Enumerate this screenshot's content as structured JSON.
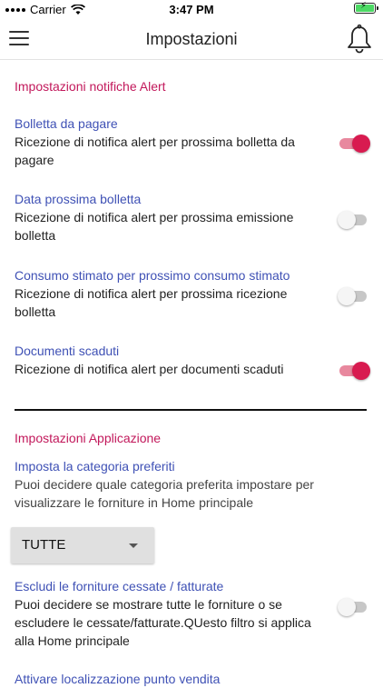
{
  "status_bar": {
    "carrier": "Carrier",
    "time": "3:47 PM"
  },
  "header": {
    "title": "Impostazioni"
  },
  "alerts_section": {
    "title": "Impostazioni notifiche Alert",
    "items": [
      {
        "title": "Bolletta da pagare",
        "desc": "Ricezione di notifica alert per prossima bolletta da pagare",
        "enabled": true
      },
      {
        "title": "Data prossima bolletta",
        "desc": "Ricezione di notifica alert per prossima emissione bolletta",
        "enabled": false
      },
      {
        "title": "Consumo stimato per prossimo consumo stimato",
        "desc": "Ricezione di notifica alert per prossima ricezione bolletta",
        "enabled": false
      },
      {
        "title": "Documenti scaduti",
        "desc": "Ricezione di notifica alert per documenti scaduti",
        "enabled": true
      }
    ]
  },
  "app_section": {
    "title": "Impostazioni Applicazione",
    "category": {
      "title": "Imposta la categoria preferiti",
      "desc": "Puoi decidere quale categoria preferita impostare per visualizzare le forniture in Home principale",
      "selected": "TUTTE"
    },
    "exclude": {
      "title": "Escludi le forniture cessate / fatturate",
      "desc": "Puoi decidere se mostrare tutte le forniture o se escludere le cessate/fatturate.QUesto filtro si applica alla Home principale",
      "enabled": false
    },
    "location": {
      "title": "Attivare localizzazione punto vendita"
    }
  },
  "colors": {
    "accent": "#c2185b",
    "link": "#3f51b5",
    "toggle_on": "#d81b50"
  }
}
